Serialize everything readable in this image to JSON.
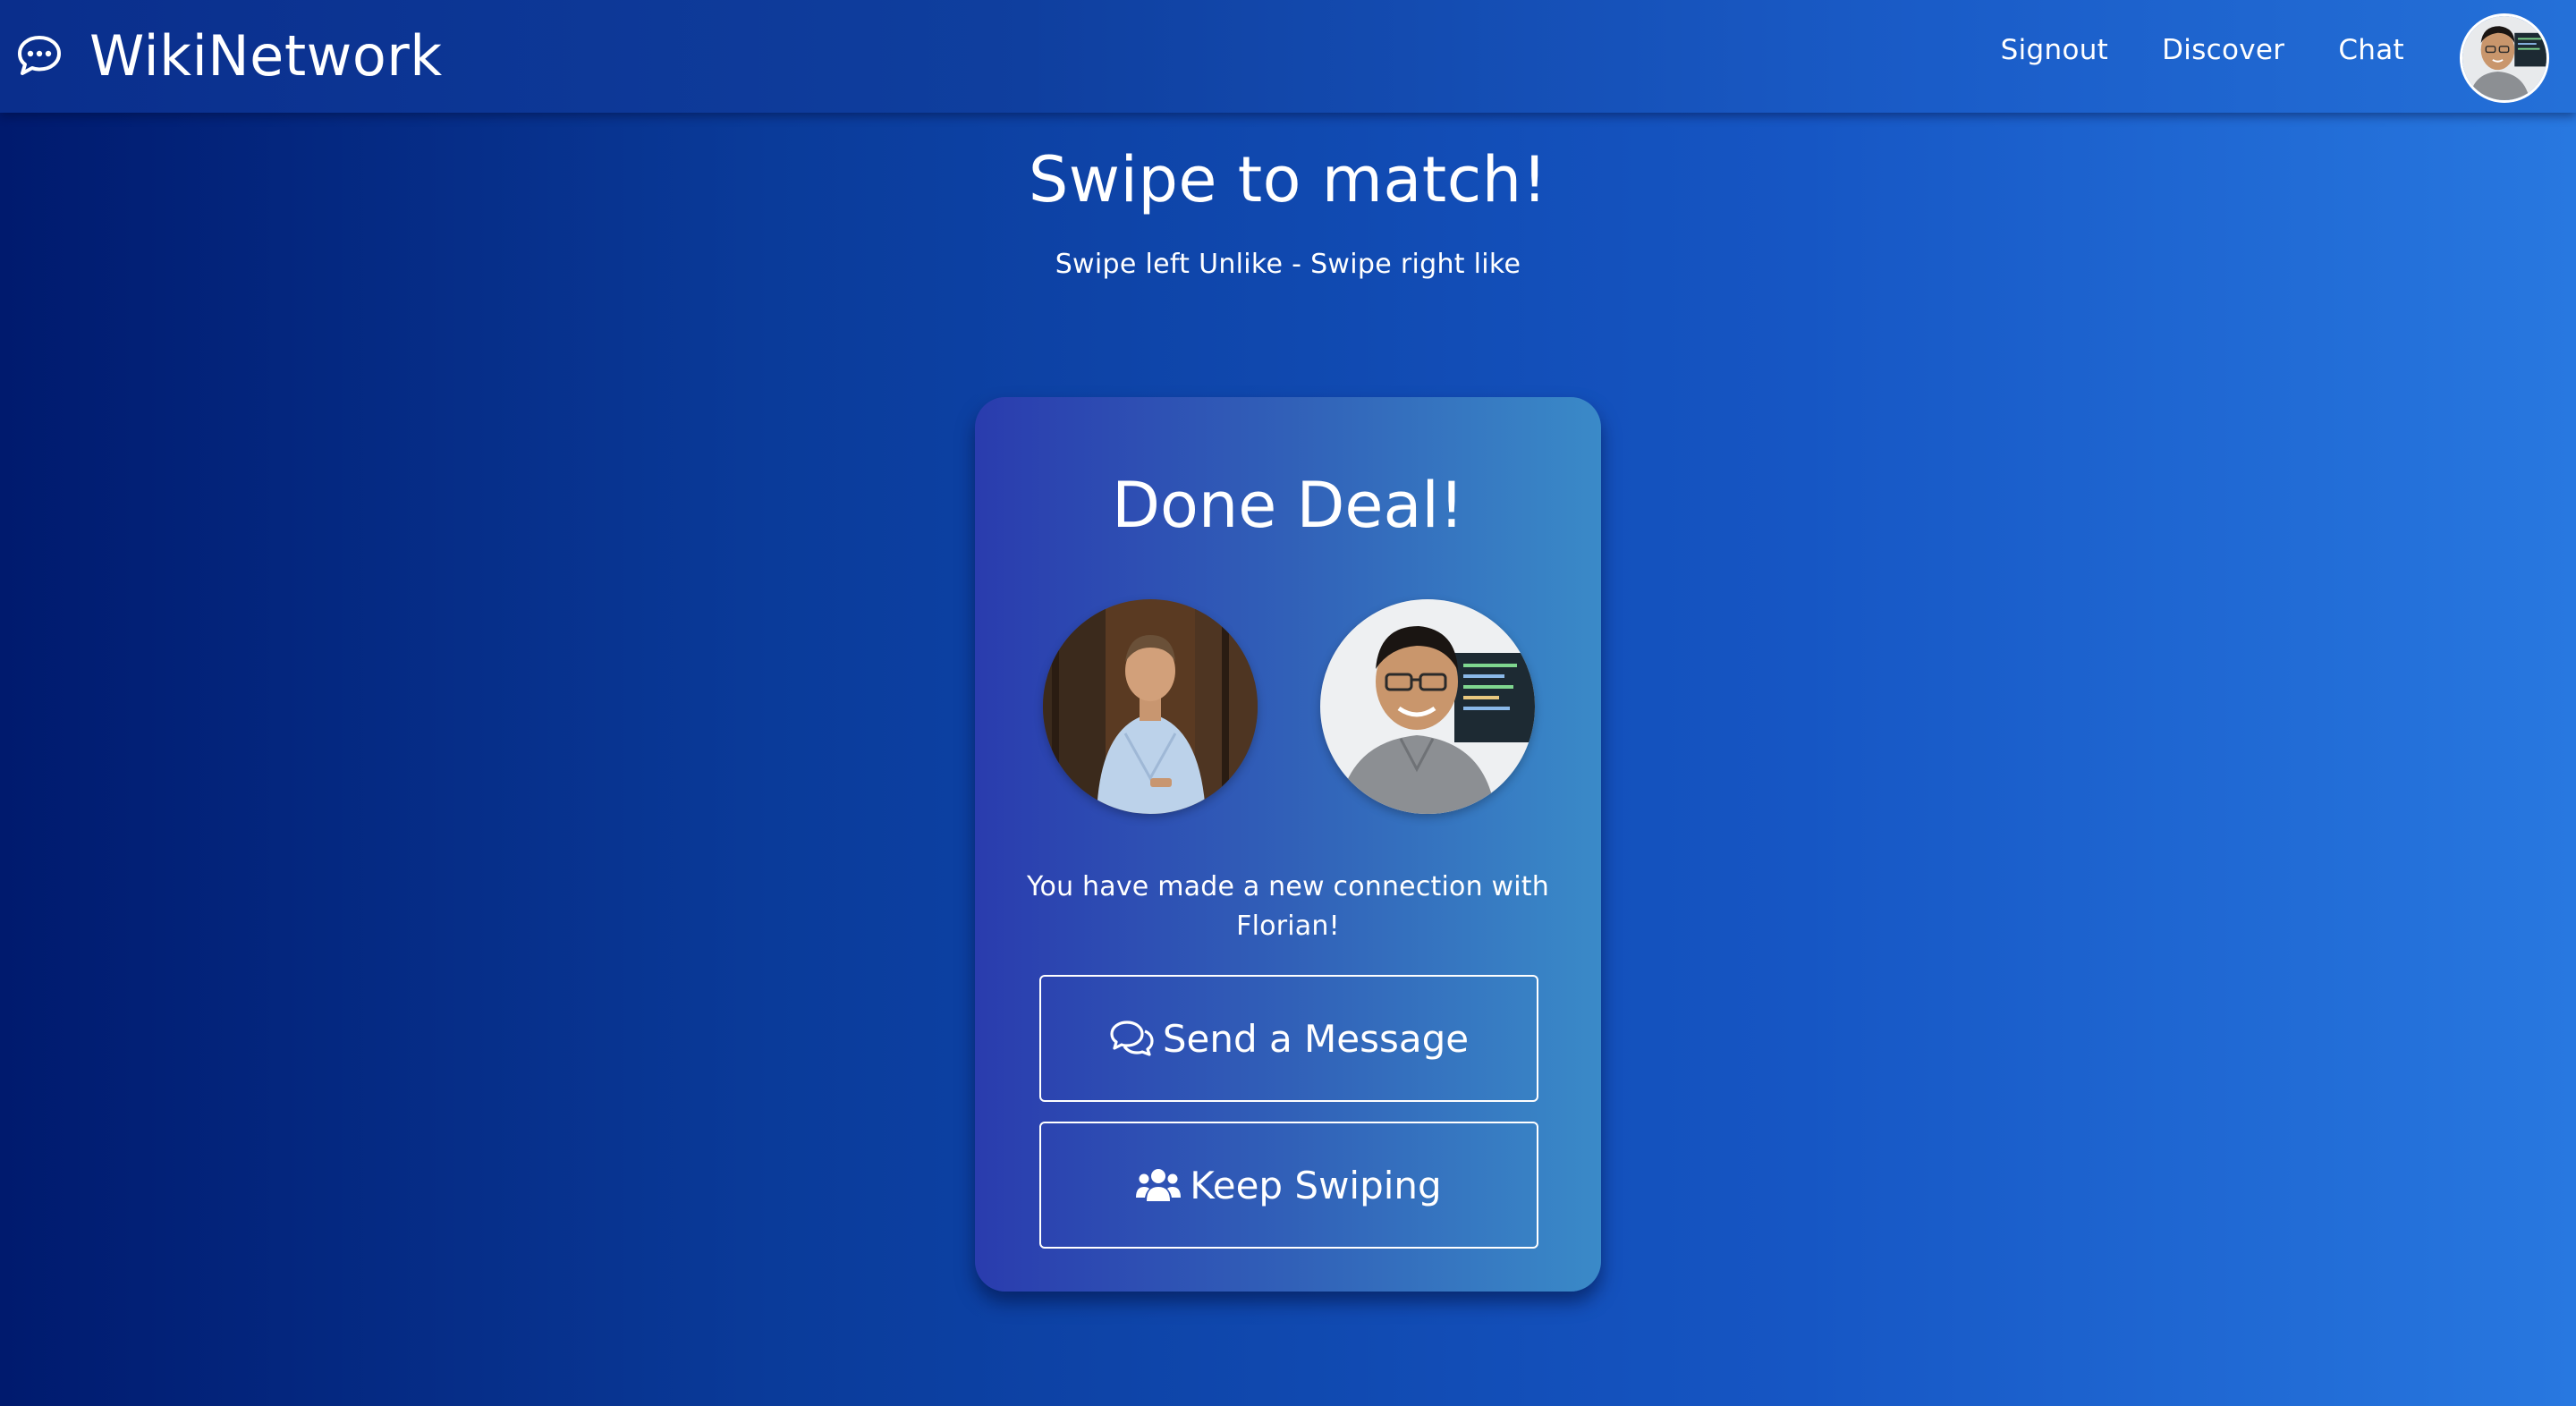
{
  "nav": {
    "brand": "WikiNetwork",
    "links": [
      "Signout",
      "Discover",
      "Chat"
    ]
  },
  "page": {
    "title": "Swipe to match!",
    "subtitle": "Swipe left Unlike - Swipe right like"
  },
  "match_card": {
    "title": "Done Deal!",
    "message": "You have made a new connection with Florian!",
    "send_message_label": "Send a Message",
    "keep_swiping_label": "Keep Swiping"
  },
  "icons": {
    "brand": "chat-bubble-icon",
    "send_message": "comments-icon",
    "keep_swiping": "users-icon"
  },
  "colors": {
    "background_start": "#001a6e",
    "background_end": "#2878e0",
    "card_start": "#2a3cae",
    "card_end": "#3a8ac8",
    "text": "#ffffff"
  }
}
